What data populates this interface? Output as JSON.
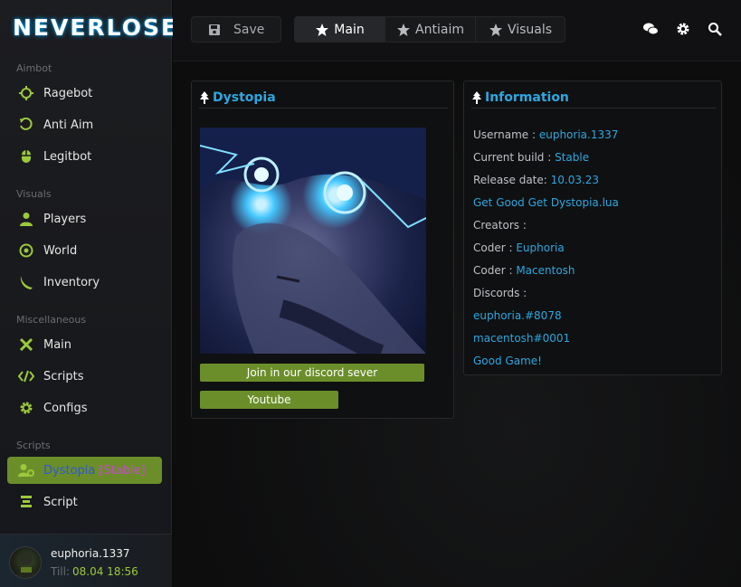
{
  "app": {
    "logo": "NEVERLOSE"
  },
  "sidebar": {
    "sections": [
      {
        "title": "Aimbot"
      },
      {
        "title": "Visuals"
      },
      {
        "title": "Miscellaneous"
      },
      {
        "title": "Scripts"
      }
    ],
    "items": [
      {
        "label": "Ragebot",
        "icon": "crosshair-icon"
      },
      {
        "label": "Anti Aim",
        "icon": "rotate-icon"
      },
      {
        "label": "Legitbot",
        "icon": "mouse-icon"
      },
      {
        "label": "Players",
        "icon": "user-icon"
      },
      {
        "label": "World",
        "icon": "globe-icon"
      },
      {
        "label": "Inventory",
        "icon": "knife-icon"
      },
      {
        "label": "Main",
        "icon": "tools-icon"
      },
      {
        "label": "Scripts",
        "icon": "code-icon"
      },
      {
        "label": "Configs",
        "icon": "gear-icon"
      },
      {
        "label": "Dystopia",
        "label_extra": "[Stable]",
        "icon": "user-cog-icon",
        "active": true
      },
      {
        "label": "Script",
        "icon": "layers-icon"
      }
    ]
  },
  "user": {
    "name": "euphoria.1337",
    "till_label": "Till:",
    "till_value": "08.04 18:56"
  },
  "toolbar": {
    "save_label": "Save",
    "tabs": [
      {
        "label": "Main",
        "active": true
      },
      {
        "label": "Antiaim"
      },
      {
        "label": "Visuals"
      }
    ]
  },
  "panels": {
    "left": {
      "title": "Dystopia",
      "discord_button": "Join in our discord sever",
      "youtube_button": "Youtube"
    },
    "right": {
      "title": "Information",
      "lines": [
        {
          "label": "Username : ",
          "value": "euphoria.1337"
        },
        {
          "label": "Current build : ",
          "value": "Stable"
        },
        {
          "label": "Release date: ",
          "value": "10.03.23"
        },
        {
          "label": "",
          "value": "Get Good Get Dystopia.lua"
        },
        {
          "label": "Creators :",
          "value": ""
        },
        {
          "label": "Coder : ",
          "value": "Euphoria"
        },
        {
          "label": "Coder : ",
          "value": "Macentosh"
        },
        {
          "label": "Discords :",
          "value": ""
        },
        {
          "label": "",
          "value": "euphoria.#8078"
        },
        {
          "label": "",
          "value": "macentosh#0001"
        },
        {
          "label": "",
          "value": "Good Game!"
        }
      ]
    }
  },
  "colors": {
    "accent_green": "#6b8e2a",
    "accent_blue": "#2ea7e0",
    "icon_green": "#9bc93a"
  }
}
